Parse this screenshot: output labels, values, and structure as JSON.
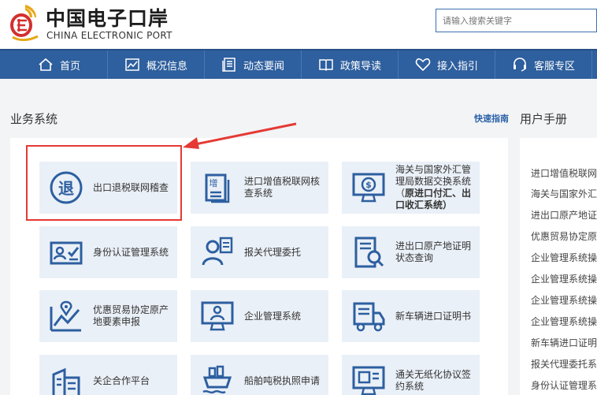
{
  "header": {
    "logo_cn": "中国电子口岸",
    "logo_en": "CHINA ELECTRONIC PORT",
    "search_placeholder": "请输入搜索关键字"
  },
  "nav": [
    {
      "label": "首页",
      "icon": "home-icon"
    },
    {
      "label": "概况信息",
      "icon": "chart-icon"
    },
    {
      "label": "动态要闻",
      "icon": "news-icon"
    },
    {
      "label": "政策导读",
      "icon": "book-icon"
    },
    {
      "label": "接入指引",
      "icon": "heart-icon"
    },
    {
      "label": "客服专区",
      "icon": "headset-icon"
    }
  ],
  "business": {
    "title": "业务系统",
    "quick_guide": "快速指南",
    "cards": [
      {
        "label": "出口退税联网稽查",
        "icon": "tax-refund-icon"
      },
      {
        "label": "进口增值税联网核查系统",
        "icon": "vat-icon"
      },
      {
        "label_pre": "海关与国家外汇管理局数据交换系统（",
        "label_bold": "原进口付汇、出口收汇系统",
        "label_post": "）",
        "icon": "forex-icon"
      },
      {
        "label": "身份认证管理系统",
        "icon": "id-card-icon"
      },
      {
        "label": "报关代理委托",
        "icon": "agent-icon"
      },
      {
        "label": "进出口原产地证明状态查询",
        "icon": "document-search-icon"
      },
      {
        "label": "优惠贸易协定原产地要素申报",
        "icon": "location-chart-icon"
      },
      {
        "label": "企业管理系统",
        "icon": "monitor-user-icon"
      },
      {
        "label": "新车辆进口证明书",
        "icon": "truck-icon"
      },
      {
        "label": "关企合作平台",
        "icon": "building-icon"
      },
      {
        "label": "船舶吨税执照申请",
        "icon": "ship-icon"
      },
      {
        "label": "通关无纸化协议签约系统",
        "icon": "computer-sign-icon"
      }
    ]
  },
  "manual": {
    "title": "用户手册",
    "items": [
      "进口增值税联网核",
      "海关与国家外汇管",
      "进出口原产地证明",
      "优惠贸易协定原产",
      "企业管理系统操作",
      "企业管理系统操作",
      "企业管理系统操作",
      "企业管理系统操作",
      "新车辆进口证明书",
      "报关代理委托系统",
      "身份认证管理系统"
    ]
  },
  "colors": {
    "nav_bg": "#2e5f9e",
    "card_bg": "#eaf0f7",
    "icon_blue": "#2d5fa0",
    "highlight_red": "#e53935",
    "link_blue": "#2d62a8"
  }
}
